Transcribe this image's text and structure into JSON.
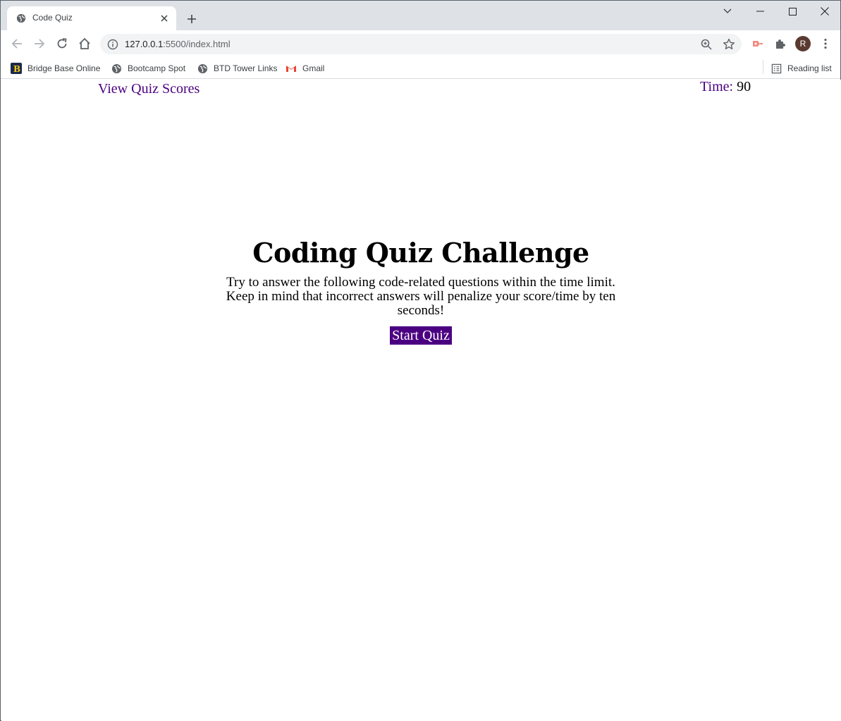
{
  "browser": {
    "tab_title": "Code Quiz",
    "url_host": "127.0.0.1",
    "url_rest": ":5500/index.html",
    "avatar_letter": "R",
    "bookmarks": [
      {
        "label": "Bridge Base Online",
        "icon": "bridge-base-icon"
      },
      {
        "label": "Bootcamp Spot",
        "icon": "globe-icon"
      },
      {
        "label": "BTD Tower Links",
        "icon": "globe-icon"
      },
      {
        "label": "Gmail",
        "icon": "gmail-icon"
      }
    ],
    "reading_list": "Reading list"
  },
  "page": {
    "scores_link": "View Quiz Scores",
    "timer_label": "Time:",
    "timer_value": "90",
    "title": "Coding Quiz Challenge",
    "description": "Try to answer the following code-related questions within the time limit. Keep in mind that incorrect answers will penalize your score/time by ten seconds!",
    "start_button": "Start Quiz"
  },
  "colors": {
    "accent": "#4b0082",
    "tabstrip": "#dee1e6"
  }
}
